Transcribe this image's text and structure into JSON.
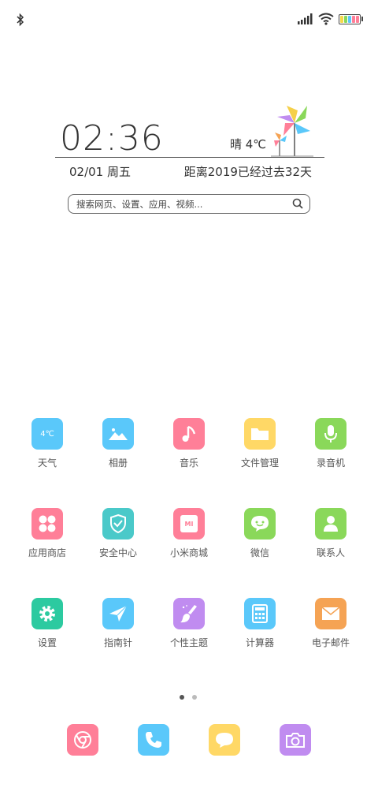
{
  "status_bar": {
    "bluetooth_icon": "bluetooth-icon",
    "signal_icon": "cell-signal-icon",
    "wifi_icon": "wifi-icon",
    "battery_icon": "battery-icon"
  },
  "widget": {
    "time": "02:36",
    "weather": "晴  4℃",
    "date": "02/01 周五",
    "countdown": "距离2019已经过去32天",
    "search_placeholder": "搜索网页、设置、应用、视频..."
  },
  "apps": [
    {
      "label": "天气",
      "icon": "weather-icon",
      "color": "#5ac8fa",
      "badge": "4℃"
    },
    {
      "label": "相册",
      "icon": "gallery-icon",
      "color": "#5ac8fa"
    },
    {
      "label": "音乐",
      "icon": "music-icon",
      "color": "#ff7f98"
    },
    {
      "label": "文件管理",
      "icon": "folder-icon",
      "color": "#ffd866"
    },
    {
      "label": "录音机",
      "icon": "microphone-icon",
      "color": "#8ad85a"
    },
    {
      "label": "应用商店",
      "icon": "app-store-icon",
      "color": "#ff7f98"
    },
    {
      "label": "安全中心",
      "icon": "shield-icon",
      "color": "#4ac9c9"
    },
    {
      "label": "小米商城",
      "icon": "mi-store-icon",
      "color": "#ff7f98",
      "badge": "MI"
    },
    {
      "label": "微信",
      "icon": "wechat-icon",
      "color": "#8ad85a"
    },
    {
      "label": "联系人",
      "icon": "contacts-icon",
      "color": "#8ad85a"
    },
    {
      "label": "设置",
      "icon": "gear-icon",
      "color": "#2ccaa0"
    },
    {
      "label": "指南针",
      "icon": "compass-icon",
      "color": "#5ac8fa"
    },
    {
      "label": "个性主题",
      "icon": "theme-brush-icon",
      "color": "#c08cf0"
    },
    {
      "label": "计算器",
      "icon": "calculator-icon",
      "color": "#5ac8fa"
    },
    {
      "label": "电子邮件",
      "icon": "mail-icon",
      "color": "#f5a354"
    }
  ],
  "page_indicator": {
    "current": 1,
    "total": 2
  },
  "dock": [
    {
      "icon": "browser-icon",
      "color": "#ff7f98"
    },
    {
      "icon": "phone-icon",
      "color": "#5ac8fa"
    },
    {
      "icon": "messages-icon",
      "color": "#ffd866"
    },
    {
      "icon": "camera-icon",
      "color": "#c08cf0"
    }
  ]
}
